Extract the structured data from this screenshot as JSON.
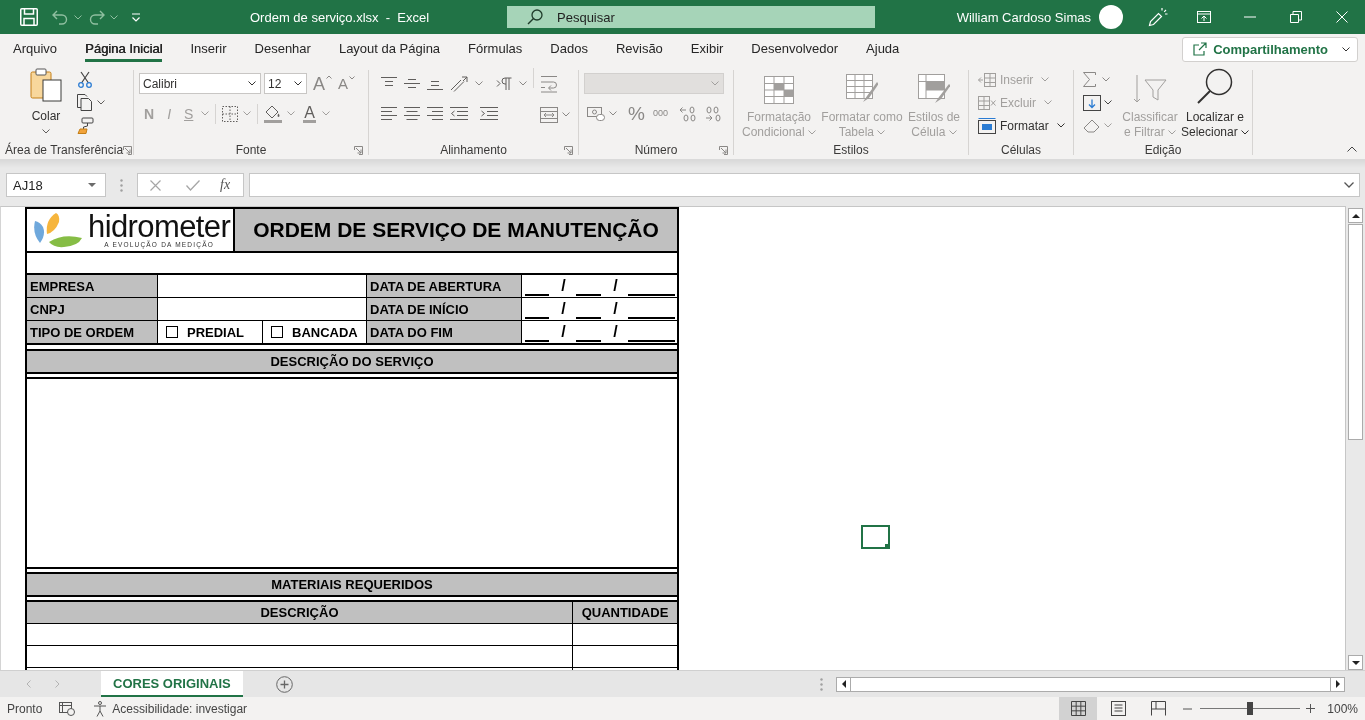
{
  "window": {
    "title": "Ordem de serviço.xlsx  -  Excel",
    "search": {
      "placeholder": "Pesquisar"
    },
    "user_name": "William Cardoso Simas"
  },
  "menu_tabs": [
    {
      "label": "Arquivo",
      "selected": false
    },
    {
      "label": "Página Inicial",
      "selected": true
    },
    {
      "label": "Inserir",
      "selected": false
    },
    {
      "label": "Desenhar",
      "selected": false
    },
    {
      "label": "Layout da Página",
      "selected": false
    },
    {
      "label": "Fórmulas",
      "selected": false
    },
    {
      "label": "Dados",
      "selected": false
    },
    {
      "label": "Revisão",
      "selected": false
    },
    {
      "label": "Exibir",
      "selected": false
    },
    {
      "label": "Desenvolvedor",
      "selected": false
    },
    {
      "label": "Ajuda",
      "selected": false
    }
  ],
  "share_button": {
    "label": "Compartilhamento"
  },
  "ribbon": {
    "clipboard": {
      "title": "Área de Transferência",
      "launcher": true,
      "paste_label": "Colar"
    },
    "font": {
      "title": "Fonte",
      "launcher": true,
      "font_name": "Calibri",
      "font_size": "12",
      "grow_label": "A",
      "shrink_label": "A",
      "style_buttons": [
        {
          "kind": "bold",
          "label": "N",
          "disabled": true
        },
        {
          "kind": "italic",
          "label": "I",
          "disabled": true
        },
        {
          "kind": "underline",
          "label": "S",
          "disabled": true
        }
      ],
      "font_color_label": "A"
    },
    "alignment": {
      "title": "Alinhamento",
      "launcher": true
    },
    "number": {
      "title": "Número",
      "launcher": true,
      "format_disabled": true,
      "percent_label": "%",
      "thousands_label": "000"
    },
    "styles": {
      "title": "Estilos",
      "buttons": [
        {
          "kind": "conditional",
          "label": "Formatação Condicional",
          "disabled": true
        },
        {
          "kind": "table",
          "label": "Formatar como Tabela",
          "disabled": true
        },
        {
          "kind": "cell_styles",
          "label": "Estilos de Célula",
          "disabled": true
        }
      ]
    },
    "cells": {
      "title": "Células",
      "buttons": [
        {
          "kind": "insert",
          "label": "Inserir",
          "disabled": true
        },
        {
          "kind": "delete",
          "label": "Excluir",
          "disabled": true
        },
        {
          "kind": "format",
          "label": "Formatar",
          "disabled": false
        }
      ]
    },
    "editing": {
      "title": "Edição",
      "buttons": [
        {
          "kind": "sort",
          "label": "Classificar e Filtrar",
          "disabled": true
        },
        {
          "kind": "find",
          "label": "Localizar e Selecionar",
          "disabled": false
        }
      ]
    }
  },
  "formula_bar": {
    "name_box": "AJ18",
    "function_label": "fx"
  },
  "sheet": {
    "logo": {
      "name": "hidrometer",
      "tagline": "A EVOLUÇÃO DA MEDIÇÃO"
    },
    "title": "ORDEM DE SERVIÇO DE MANUTENÇÃO",
    "info_rows": [
      {
        "kind": "text",
        "label": "EMPRESA",
        "date_label": "DATA DE ABERTURA",
        "date_separators": [
          "/",
          "/"
        ]
      },
      {
        "kind": "text",
        "label": "CNPJ",
        "date_label": "DATA DE INÍCIO",
        "date_separators": [
          "/",
          "/"
        ]
      },
      {
        "kind": "options",
        "label": "TIPO DE ORDEM",
        "options": [
          {
            "label": "PREDIAL",
            "checked": false
          },
          {
            "label": "BANCADA",
            "checked": false
          }
        ],
        "date_label": "DATA DO FIM",
        "date_separators": [
          "/",
          "/"
        ]
      }
    ],
    "description_header": "DESCRIÇÃO DO SERVIÇO",
    "materials_header": "MATERIAIS REQUERIDOS",
    "materials_columns": [
      "DESCRIÇÃO",
      "QUANTIDADE"
    ]
  },
  "sheet_tabs": [
    {
      "label": "CORES ORIGINAIS",
      "selected": true
    }
  ],
  "status_bar": {
    "status": "Pronto",
    "accessibility": "Acessibilidade: investigar",
    "views": [
      {
        "kind": "normal",
        "selected": true
      },
      {
        "kind": "page_layout",
        "selected": false
      },
      {
        "kind": "page_break",
        "selected": false
      }
    ],
    "zoom": {
      "level": 0.5,
      "reading": "100%"
    }
  }
}
